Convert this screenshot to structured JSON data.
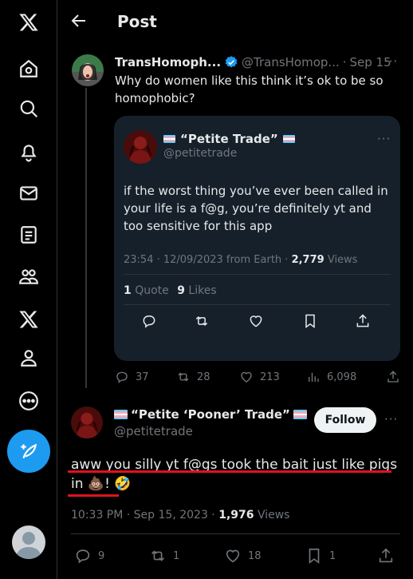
{
  "header": {
    "title": "Post"
  },
  "sidebar": {
    "items": [
      "x-logo-icon",
      "home-icon",
      "search-icon",
      "notifications-icon",
      "messages-icon",
      "lists-icon",
      "communities-icon",
      "premium-icon",
      "profile-icon",
      "more-icon"
    ]
  },
  "tweet": {
    "name": "TransHomoph...",
    "handle": "@TransHomop...",
    "sep": "·",
    "date": "Sep 15",
    "more": "···",
    "text": "Why do women like this think it’s ok to be so homophobic?",
    "actions": {
      "replies": "37",
      "reposts": "28",
      "likes": "213",
      "views": "6,098"
    }
  },
  "quote": {
    "name": "“Petite Trade”",
    "handle": "@petitetrade",
    "more": "···",
    "text": "if the worst thing you’ve ever been called in your life is a f@g, you’re definitely yt and too sensitive for this app",
    "meta_prefix": "23:54 · 12/09/2023 from Earth · ",
    "views_count": "2,779",
    "views_label": " Views",
    "quote_count": "1",
    "quote_label": " Quote",
    "likes_count": "9",
    "likes_label": " Likes"
  },
  "reply": {
    "name": "“Petite ‘Pooner’ Trade”",
    "handle": "@petitetrade",
    "follow_label": "Follow",
    "more": "···",
    "text": "aww you silly yt f@gs took the bait just like pigs in 💩! 🤣",
    "meta_prefix": "10:33 PM · Sep 15, 2023 · ",
    "views_count": "1,976",
    "views_label": " Views",
    "actions": {
      "replies": "9",
      "reposts": "1",
      "likes": "18",
      "bookmarks": "1"
    }
  },
  "colors": {
    "accent": "#1d9bf0",
    "verified": "#1d9bf0",
    "underline": "#e0121c",
    "quote_bg": "#15202b"
  }
}
